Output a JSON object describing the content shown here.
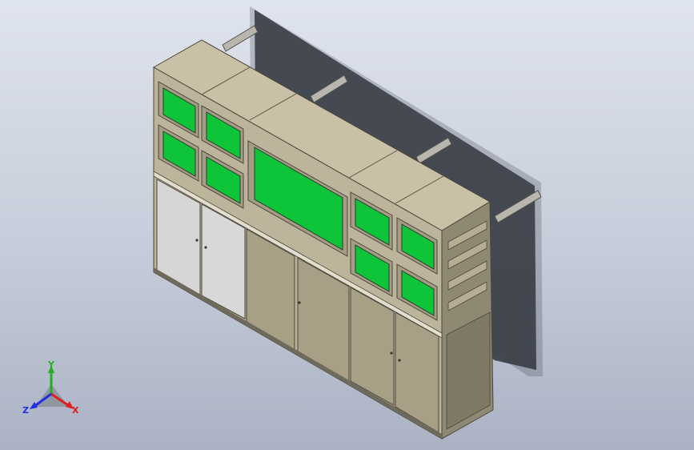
{
  "model": {
    "name": "monitor-wall-console",
    "colors": {
      "background_top": "#dfe4ee",
      "background_bottom": "#aab2c4",
      "frame_face": "#bdb49c",
      "frame_top": "#c9c0a6",
      "frame_side": "#8f8873",
      "screen_green": "#0ec53a",
      "screen_bezel": "#a49c84",
      "door_light": "#d6d6d6",
      "door_dark": "#a79f86",
      "shadow": "#3c4048"
    },
    "screens_count": 9,
    "doors_count": 6
  },
  "triad": {
    "x_label": "X",
    "y_label": "Y",
    "z_label": "Z",
    "x_color": "#e02020",
    "y_color": "#20b020",
    "z_color": "#2030e0"
  }
}
